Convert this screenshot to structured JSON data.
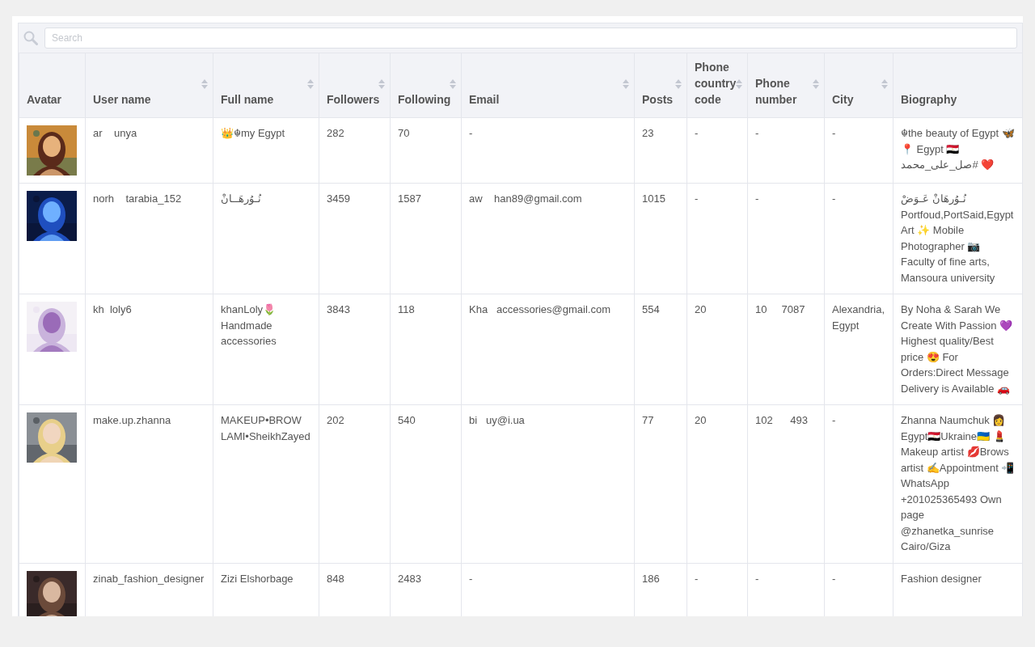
{
  "search": {
    "placeholder": "Search"
  },
  "columns": [
    {
      "label": "Avatar",
      "sortable": false
    },
    {
      "label": "User name",
      "sortable": true
    },
    {
      "label": "Full name",
      "sortable": true
    },
    {
      "label": "Followers",
      "sortable": true
    },
    {
      "label": "Following",
      "sortable": true
    },
    {
      "label": "Email",
      "sortable": true
    },
    {
      "label": "Posts",
      "sortable": true
    },
    {
      "label": "Phone country code",
      "sortable": true
    },
    {
      "label": "Phone number",
      "sortable": true
    },
    {
      "label": "City",
      "sortable": true
    },
    {
      "label": "Biography",
      "sortable": false
    }
  ],
  "rows": [
    {
      "avatar": {
        "kind": "picture"
      },
      "cells": [
        "ar    unya",
        "👑☬my Egypt",
        "282",
        "70",
        "-",
        "23",
        "-",
        "-",
        "-",
        "☬the beauty of Egypt 🦋📍 Egypt 🇪🇬 صل_على_محمد# ❤️"
      ]
    },
    {
      "avatar": {
        "kind": "picture"
      },
      "cells": [
        "norh    tarabia_152",
        "نُـوُرهَــانْ",
        "3459",
        "1587",
        "aw    han89@gmail.com",
        "1015",
        "-",
        "-",
        "-",
        "نُـوُرهَانْ عَـوَضْ Portfoud,PortSaid,Egypt Art ✨ Mobile Photographer 📷 Faculty of fine arts, Mansoura university"
      ]
    },
    {
      "avatar": {
        "kind": "picture"
      },
      "cells": [
        "kh  loly6",
        "khanLoly🌷 Handmade accessories",
        "3843",
        "118",
        "Kha   accessories@gmail.com",
        "554",
        "20",
        "10     7087",
        "Alexandria, Egypt",
        "By Noha & Sarah We Create With Passion 💜 Highest quality/Best price 😍 For Orders:Direct Message Delivery is Available 🚗"
      ]
    },
    {
      "avatar": {
        "kind": "picture"
      },
      "cells": [
        "make.up.zhanna",
        "MAKEUP•BROW LAMI•SheikhZayed",
        "202",
        "540",
        "bi   uy@i.ua",
        "77",
        "20",
        "102      493",
        "-",
        "Zhanna Naumchuk 👩 Egypt🇪🇬Ukraine🇺🇦 💄 Makeup artist 💋Brows artist ✍️Appointment 📲WhatsApp +201025365493 Own page @zhanetka_sunrise Cairo/Giza"
      ]
    },
    {
      "avatar": {
        "kind": "picture"
      },
      "cells": [
        "zinab_fashion_designer",
        "Zizi Elshorbage",
        "848",
        "2483",
        "-",
        "186",
        "-",
        "-",
        "-",
        "Fashion designer"
      ]
    }
  ]
}
